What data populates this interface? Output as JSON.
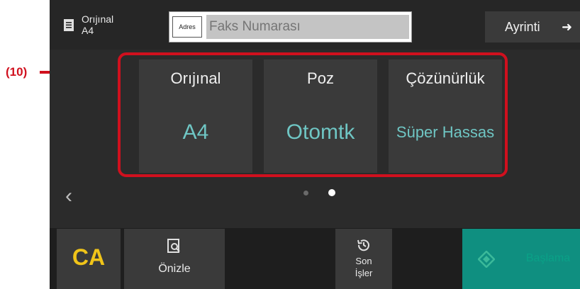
{
  "callout": {
    "label": "(10)"
  },
  "header": {
    "original_label": "Orıjınal",
    "original_size": "A4",
    "address_button": "Adres",
    "fax_placeholder": "Faks Numarası",
    "detail_button": "Ayrinti"
  },
  "cards": [
    {
      "title": "Orıjınal",
      "value": "A4"
    },
    {
      "title": "Poz",
      "value": "Otomtk"
    },
    {
      "title": "Çözünürlük",
      "value": "Süper Hassas"
    }
  ],
  "pager": {
    "pages": 2,
    "current_page": 2
  },
  "footer": {
    "ca_label": "CA",
    "preview_label": "Önizle",
    "recent_line1": "Son",
    "recent_line2": "İşler",
    "start_label": "Başlama"
  },
  "colors": {
    "accent_red": "#d0101e",
    "value_teal": "#6fc6c4",
    "ca_yellow": "#f0c419",
    "start_green": "#0f8f80"
  },
  "icons": [
    "document-icon",
    "arrow-right-icon",
    "chevron-left-icon",
    "preview-icon",
    "history-icon",
    "start-diamond-icon"
  ]
}
